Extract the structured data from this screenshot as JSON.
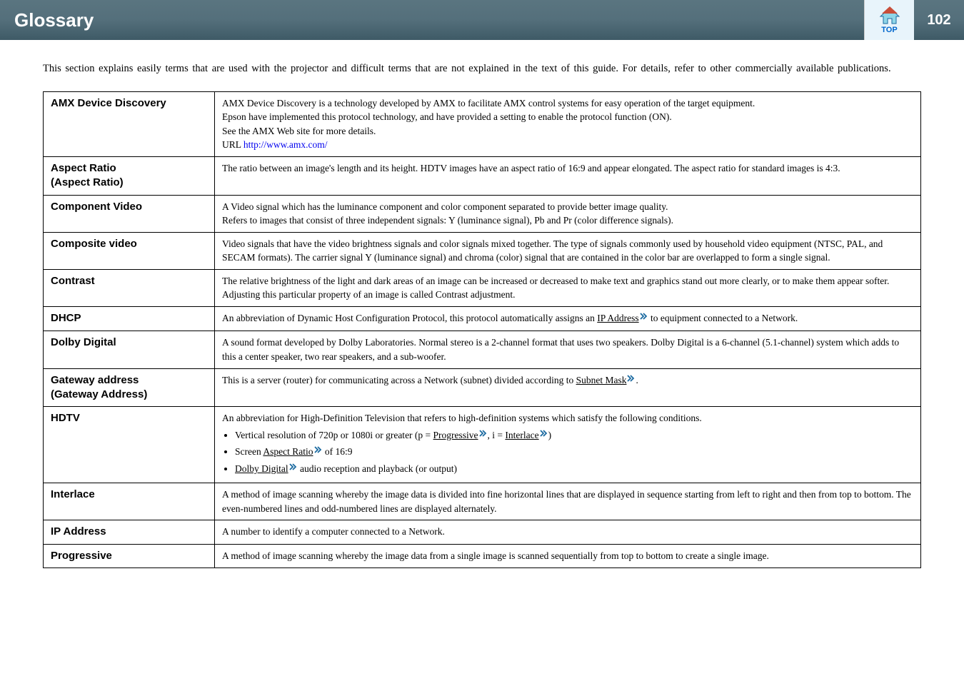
{
  "header": {
    "title": "Glossary",
    "page_number": "102",
    "top_label": "TOP"
  },
  "intro": "This section explains easily terms that are used with the projector and difficult terms that are not explained in the text of this guide. For details, refer to other commercially available publications.",
  "rows": {
    "amx": {
      "term": "AMX Device Discovery",
      "line1": "AMX Device Discovery is a technology developed by AMX to facilitate AMX control systems for easy operation of the target equipment.",
      "line2": "Epson have implemented this protocol technology, and have provided a setting to enable the protocol function (ON).",
      "line3": "See the AMX Web site for more details.",
      "line4_prefix": "URL ",
      "line4_url": "http://www.amx.com/"
    },
    "aspect": {
      "term": "Aspect Ratio\n(Aspect Ratio)",
      "def": "The ratio between an image's length and its height. HDTV images have an aspect ratio of 16:9 and appear elongated. The aspect ratio for standard images is 4:3."
    },
    "component": {
      "term": "Component Video",
      "line1": "A Video signal which has the luminance component and color component separated to provide better image quality.",
      "line2": "Refers to images that consist of three independent signals: Y (luminance signal), Pb and Pr (color difference signals)."
    },
    "composite": {
      "term": "Composite video",
      "def": "Video signals that have the video brightness signals and color signals mixed together. The type of signals commonly used by household video equipment (NTSC, PAL, and SECAM formats). The carrier signal Y (luminance signal) and chroma (color) signal that are contained in the color bar are overlapped to form a single signal."
    },
    "contrast": {
      "term": "Contrast",
      "def": "The relative brightness of the light and dark areas of an image can be increased or decreased to make text and graphics stand out more clearly, or to make them appear softer. Adjusting this particular property of an image is called Contrast adjustment."
    },
    "dhcp": {
      "term": "DHCP",
      "pre": "An abbreviation of Dynamic Host Configuration Protocol, this protocol automatically assigns an ",
      "ref": "IP Address",
      "post": " to equipment connected to a Network."
    },
    "dolby": {
      "term": "Dolby Digital",
      "def": "A sound format developed by Dolby Laboratories. Normal stereo is a 2-channel format that uses two speakers. Dolby Digital is a 6-channel (5.1-channel) system which adds to this a center speaker, two rear speakers, and a sub-woofer."
    },
    "gateway": {
      "term": "Gateway address\n(Gateway Address)",
      "pre": "This is a server (router) for communicating across a Network (subnet) divided according to ",
      "ref": "Subnet Mask",
      "post": "."
    },
    "hdtv": {
      "term": "HDTV",
      "intro": "An abbreviation for High-Definition Television that refers to high-definition systems which satisfy the following conditions.",
      "b1_a": "Vertical resolution of 720p or 1080i or greater (p = ",
      "b1_ref1": "Progressive",
      "b1_b": ", i = ",
      "b1_ref2": "Interlace",
      "b1_c": ")",
      "b2_a": "Screen ",
      "b2_ref": "Aspect Ratio",
      "b2_b": " of 16:9",
      "b3_ref": "Dolby Digital",
      "b3_b": " audio reception and playback (or output)"
    },
    "interlace": {
      "term": "Interlace",
      "def": "A method of image scanning whereby the image data is divided into fine horizontal lines that are displayed in sequence starting from left to right and then from top to bottom. The even-numbered lines and odd-numbered lines are displayed alternately."
    },
    "ip": {
      "term": "IP Address",
      "def": "A number to identify a computer connected to a Network."
    },
    "progressive": {
      "term": "Progressive",
      "def": "A method of image scanning whereby the image data from a single image is scanned sequentially from top to bottom to create a single image."
    }
  }
}
